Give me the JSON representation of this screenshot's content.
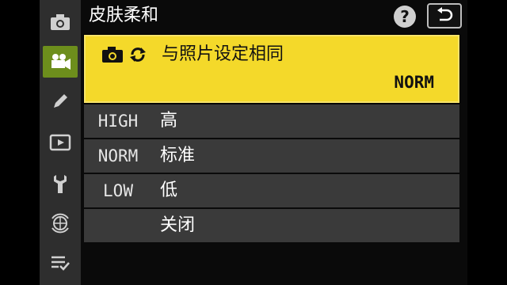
{
  "header": {
    "title": "皮肤柔和",
    "help_label": "?"
  },
  "sidebar": {
    "items": [
      {
        "icon": "camera-icon",
        "active": false
      },
      {
        "icon": "movie-camera-icon",
        "active": true
      },
      {
        "icon": "pencil-icon",
        "active": false
      },
      {
        "icon": "playback-icon",
        "active": false
      },
      {
        "icon": "wrench-icon",
        "active": false
      },
      {
        "icon": "network-icon",
        "active": false
      },
      {
        "icon": "my-menu-icon",
        "active": false
      }
    ]
  },
  "menu": {
    "selected": {
      "label": "与照片设定相同",
      "value": "NORM"
    },
    "options": [
      {
        "code": "HIGH",
        "label": "高"
      },
      {
        "code": "NORM",
        "label": "标准"
      },
      {
        "code": "LOW",
        "label": "低"
      },
      {
        "code": "",
        "label": "关闭"
      }
    ]
  },
  "colors": {
    "selected_bg": "#f4d92a",
    "active_tab": "#6d8e1c",
    "row_bg": "#3a3a3a"
  }
}
